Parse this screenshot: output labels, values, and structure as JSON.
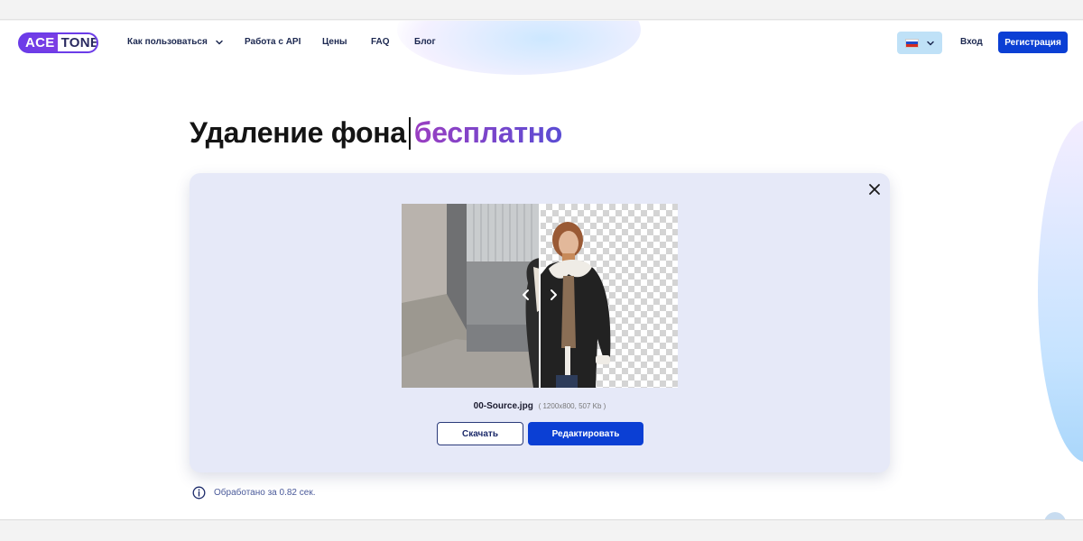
{
  "header": {
    "logo": {
      "left": "ACE",
      "right": "TONE"
    },
    "nav": [
      {
        "label": "Как пользоваться"
      },
      {
        "label": "Работа с API"
      },
      {
        "label": "Цены"
      },
      {
        "label": "FAQ"
      },
      {
        "label": "Блог"
      }
    ],
    "language_icon": "flag-russia-icon",
    "login_label": "Вход",
    "signup_label": "Регистрация"
  },
  "hero": {
    "title_main": "Удаление фона",
    "title_accent": "бесплатно"
  },
  "card": {
    "close_icon": "close-icon",
    "file_name": "00-Source.jpg",
    "file_meta": "( 1200x800, 507 Kb )",
    "download_label": "Скачать",
    "edit_label": "Редактировать"
  },
  "status": {
    "processed_text": "Обработано за 0.82 сек."
  },
  "colors": {
    "primary": "#0b3fd4",
    "accent_gradient_start": "#9a3ec1",
    "accent_gradient_end": "#5b4dd4",
    "card_bg": "#e6e9f8",
    "logo_purple": "#6b3ce8"
  }
}
